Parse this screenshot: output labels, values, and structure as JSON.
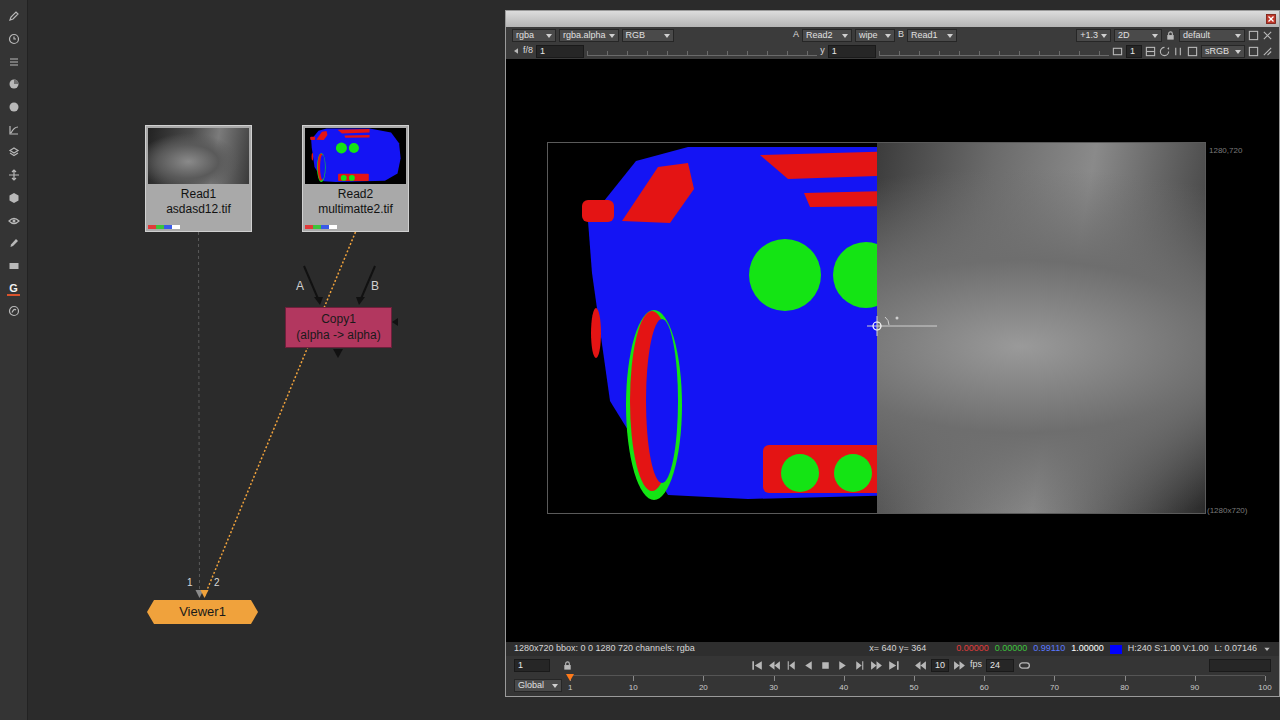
{
  "toolbar": {
    "g_label": "G"
  },
  "nodes": [
    {
      "kind": "read",
      "name": "Read1",
      "file": "asdasd12.tif",
      "thumbnail": "photo"
    },
    {
      "kind": "read",
      "name": "Read2",
      "file": "multimatte2.tif",
      "thumbnail": "matte"
    },
    {
      "kind": "copy",
      "name": "Copy1",
      "label": "(alpha -> alpha)",
      "inputs": [
        "A",
        "B"
      ]
    },
    {
      "kind": "viewer",
      "name": "Viewer1",
      "inputs": [
        "1",
        "2"
      ]
    }
  ],
  "connections": [
    {
      "from": "Read1",
      "to": "Viewer1",
      "selected": false
    },
    {
      "from": "Read2",
      "to": "Viewer1",
      "selected": true
    }
  ],
  "viewer": {
    "toolbar": {
      "channels": "rgba",
      "alpha_channel": "rgba.alpha",
      "display_channels": "RGB",
      "a_label": "A",
      "a_input": "Read2",
      "compare_mode": "wipe",
      "b_label": "B",
      "b_input": "Read1",
      "zoom": "+1.3",
      "view_mode": "2D",
      "lut": "default"
    },
    "controls": {
      "fstop": "f/8",
      "gain": "1",
      "gamma_label": "y",
      "gamma": "1",
      "proxy": "1",
      "colorspace": "sRGB"
    },
    "format_corner": "1280,720",
    "format_label": "(1280x720)",
    "wipe": {
      "level": 0.5
    },
    "status": {
      "info": "1280x720 bbox: 0 0 1280 720 channels: rgba",
      "coords": "x= 640 y= 364",
      "values": [
        {
          "text": "0.00000",
          "color": "#e03a3a"
        },
        {
          "text": "0.00000",
          "color": "#3cc43c"
        },
        {
          "text": "0.99110",
          "color": "#5a78ff"
        },
        {
          "text": "1.00000",
          "color": "#ffffff"
        }
      ],
      "swatch_color": "#0000ff",
      "hsv": "H:240 S:1.00 V:1.00",
      "luma": "L: 0.07146"
    },
    "playback": {
      "frame": "1",
      "increment": "10",
      "fps_label": "fps",
      "fps": "24"
    },
    "timeline": {
      "scope": "Global",
      "ticks": [
        "1",
        "10",
        "20",
        "30",
        "40",
        "50",
        "60",
        "70",
        "80",
        "90",
        "100"
      ],
      "level": 0
    }
  }
}
